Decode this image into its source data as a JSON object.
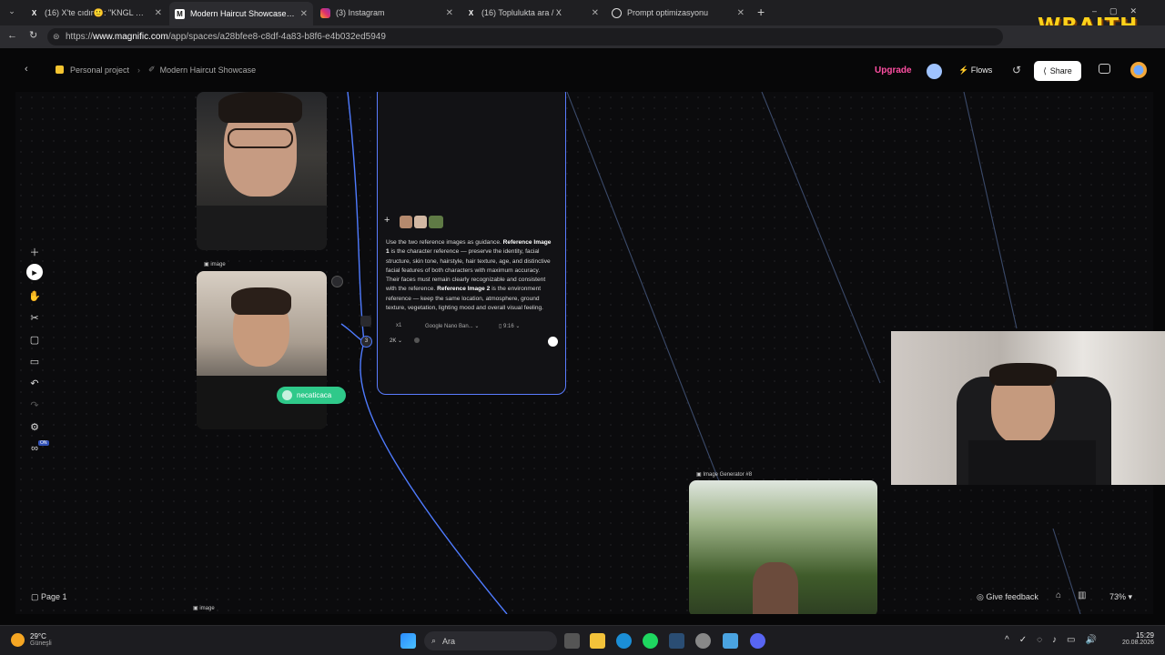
{
  "browser": {
    "tabs": [
      {
        "label": "(16) X'te cıdır🙂: \"KNGL EKİP (PAR",
        "icon": "x-logo-icon"
      },
      {
        "label": "Modern Haircut Showcase - Space",
        "icon": "magnific-icon",
        "active": true
      },
      {
        "label": "(3) Instagram",
        "icon": "instagram-icon"
      },
      {
        "label": "(16) Toplulukta ara / X",
        "icon": "x-logo-icon"
      },
      {
        "label": "Prompt optimizasyonu",
        "icon": "chatgpt-icon"
      }
    ],
    "url_prefix": "https://",
    "url_host": "www.magnific.com",
    "url_path": "/app/spaces/a28bfee8-c8df-4a83-b8f6-e4b032ed5949",
    "overlay_logo": "WRAITH"
  },
  "app": {
    "breadcrumb": {
      "project": "Personal project",
      "space": "Modern Haircut Showcase"
    },
    "upgrade": "Upgrade",
    "flows": "Flows",
    "share": "Share",
    "page_label": "Page 1",
    "feedback": "Give feedback",
    "zoom": "73%",
    "on_badge": "ON",
    "nodes": {
      "image_label_1": "image",
      "image_label_2": "image",
      "generator_label": "Image Generator #8",
      "user_chip": "necaticaca",
      "connector_count": "3"
    },
    "prompt": {
      "p1": "Use the two reference images as guidance. ",
      "b1": "Reference Image 1",
      "p2": " is the character reference — preserve the identity, facial structure, skin tone, hairstyle, hair texture, age, and distinctive facial features of both characters with maximum accuracy. Their faces must remain clearly recognizable and consistent with the reference. ",
      "b2": "Reference Image 2",
      "p3": " is the environment reference — keep the same location, atmosphere, ground texture, vegetation, lighting mood and overall visual feeling.",
      "count": "x1",
      "model": "Google Nano Ban...",
      "ratio": "9:16",
      "resolution": "2K"
    }
  },
  "taskbar": {
    "weather_temp": "29°C",
    "weather_desc": "Güneşli",
    "search": "Ara",
    "time": "15:29",
    "date": "20.08.2026"
  },
  "colors": {
    "accent_blue": "#5a7cff",
    "upgrade_pink": "#ff4fa3",
    "chip_green": "#2fc98a"
  }
}
